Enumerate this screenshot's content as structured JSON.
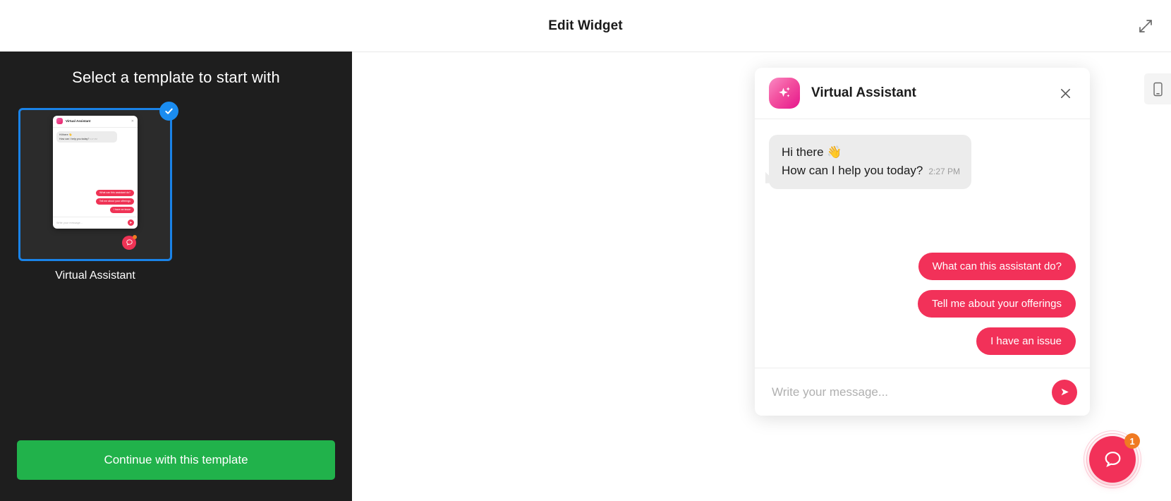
{
  "header": {
    "title": "Edit Widget",
    "expand_icon": "expand-diagonal-icon"
  },
  "sidebar": {
    "heading": "Select a template to start with",
    "templates": [
      {
        "label": "Virtual Assistant",
        "selected": true,
        "check_icon": "check-icon"
      }
    ],
    "continue_button": "Continue with this template"
  },
  "widget": {
    "avatar_icon": "sparkle-icon",
    "title": "Virtual Assistant",
    "close_icon": "close-icon",
    "messages": [
      {
        "line1": "Hi there 👋",
        "line2": "How can I help you today?",
        "time": "2:27 PM"
      }
    ],
    "quick_replies": [
      "What can this assistant do?",
      "Tell me about your offerings",
      "I have an issue"
    ],
    "input": {
      "value": "",
      "placeholder": "Write your message...",
      "send_icon": "send-icon"
    }
  },
  "device_tab": {
    "icon": "mobile-icon"
  },
  "launcher": {
    "icon": "chat-bubble-icon",
    "badge": "1"
  },
  "colors": {
    "accent_pink": "#f23159",
    "avatar_gradient_start": "#fa8bc4",
    "avatar_gradient_end": "#e6168c",
    "continue_green": "#21b24b",
    "selection_blue": "#1a83e8",
    "badge_orange": "#f07a22",
    "sidebar_dark": "#1e1e1e",
    "bubble_gray": "#ececec"
  }
}
